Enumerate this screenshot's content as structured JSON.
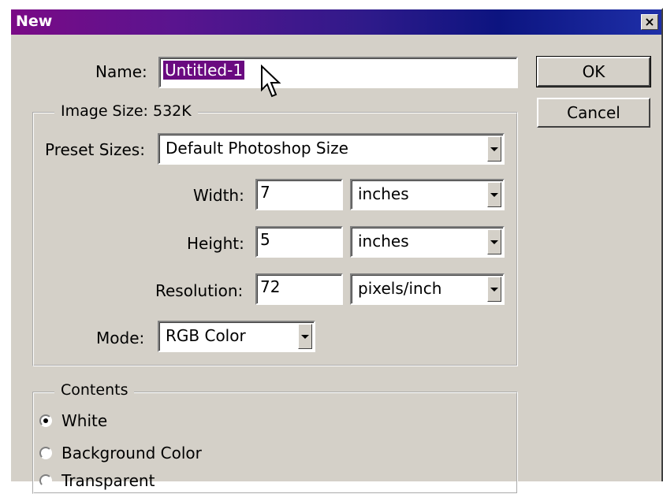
{
  "window": {
    "title": "New",
    "close": "×"
  },
  "name": {
    "label": "Name:",
    "value": "Untitled-1"
  },
  "buttons": {
    "ok": "OK",
    "cancel": "Cancel"
  },
  "image_size": {
    "legend": "Image Size: 532K",
    "preset_label": "Preset Sizes:",
    "preset_value": "Default Photoshop Size",
    "width_label": "Width:",
    "width_value": "7",
    "width_unit": "inches",
    "height_label": "Height:",
    "height_value": "5",
    "height_unit": "inches",
    "resolution_label": "Resolution:",
    "resolution_value": "72",
    "resolution_unit": "pixels/inch",
    "mode_label": "Mode:",
    "mode_value": "RGB Color"
  },
  "contents": {
    "legend": "Contents",
    "options": [
      {
        "label": "White",
        "selected": true
      },
      {
        "label": "Background Color",
        "selected": false
      },
      {
        "label": "Transparent",
        "selected": false
      }
    ]
  },
  "colors": {
    "title_start": "#7a0a86",
    "title_end": "#1e2fa8",
    "selection": "#6a0a80",
    "face": "#d4d0c8"
  }
}
